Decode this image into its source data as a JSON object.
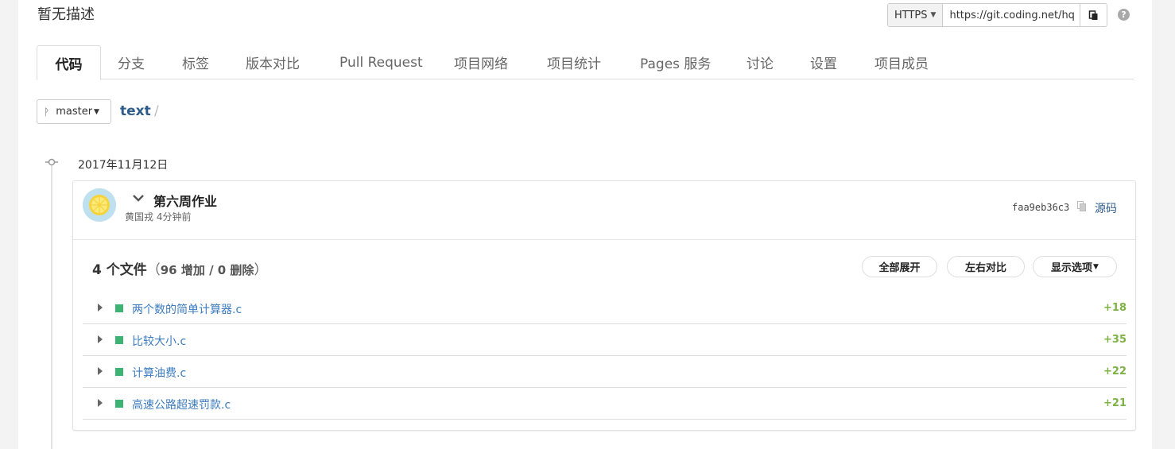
{
  "repo": {
    "description": "暂无描述",
    "clone": {
      "protocol": "HTTPS",
      "url": "https://git.coding.net/hq"
    }
  },
  "tabs": [
    {
      "label": "代码",
      "active": true
    },
    {
      "label": "分支"
    },
    {
      "label": "标签"
    },
    {
      "label": "版本对比"
    },
    {
      "label": "Pull Request"
    },
    {
      "label": "项目网络"
    },
    {
      "label": "项目统计"
    },
    {
      "label": "Pages 服务"
    },
    {
      "label": "讨论"
    },
    {
      "label": "设置"
    },
    {
      "label": "项目成员"
    }
  ],
  "branch": {
    "name": "master"
  },
  "breadcrumb": {
    "path": "text",
    "sep": "/"
  },
  "timeline": {
    "date": "2017年11月12日"
  },
  "commit": {
    "title": "第六周作业",
    "author_time": "黄国戎 4分钟前",
    "sha": "faa9eb36c3",
    "source_label": "源码"
  },
  "files_summary": {
    "count_label": "4 个文件",
    "open_paren": "（",
    "stats": "96 增加 / 0 删除",
    "close_paren": "）"
  },
  "actions": {
    "expand_all": "全部展开",
    "side_by_side": "左右对比",
    "display_options": "显示选项"
  },
  "files": [
    {
      "name": "两个数的简单计算器.c",
      "additions": "+18"
    },
    {
      "name": "比较大小.c",
      "additions": "+35"
    },
    {
      "name": "计算油费.c",
      "additions": "+22"
    },
    {
      "name": "高速公路超速罚款.c",
      "additions": "+21"
    }
  ],
  "colors": {
    "link": "#3b7bbf",
    "added": "#7cb342",
    "file_added_marker": "#3cb371",
    "breadcrumb": "#2e5c8a"
  }
}
